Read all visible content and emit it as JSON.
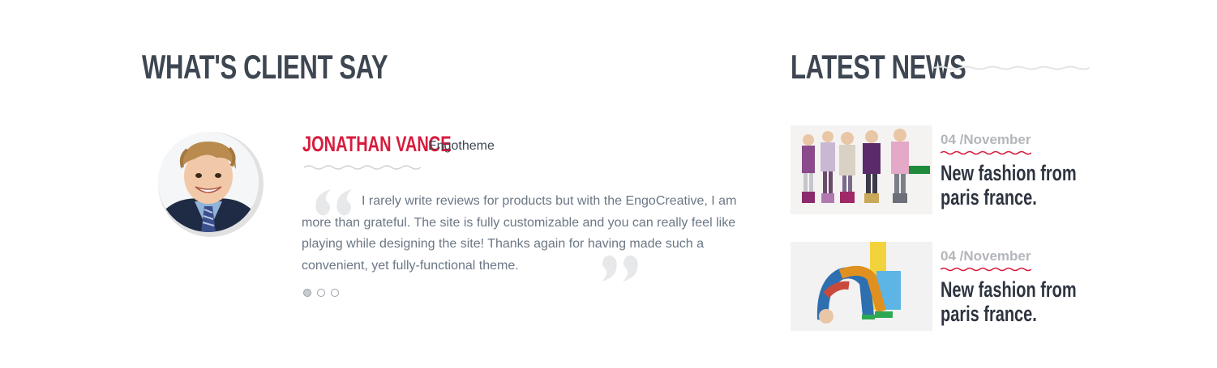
{
  "testimonials": {
    "heading": "WHAT'S CLIENT SAY",
    "client": {
      "name": "JONATHAN VANCE",
      "company": "Engotheme",
      "quote": "I rarely write reviews for products but with the EngoCreative, I am more than grateful. The site is fully customizable and you can really feel like playing while designing the site! Thanks again for having made such a convenient, yet fully-functional theme."
    },
    "pagination": {
      "count": 3,
      "active": 1
    },
    "accent_color": "#d71b3c"
  },
  "latest_news": {
    "heading": "LATEST NEWS",
    "items": [
      {
        "date": "04 /November",
        "title": "New fashion from paris france."
      },
      {
        "date": "04 /November",
        "title": "New fashion from paris france."
      }
    ]
  },
  "colors": {
    "heading": "#3d4651",
    "accent": "#d71b3c",
    "body_text": "#6b7785",
    "date": "#b3b6ba"
  }
}
